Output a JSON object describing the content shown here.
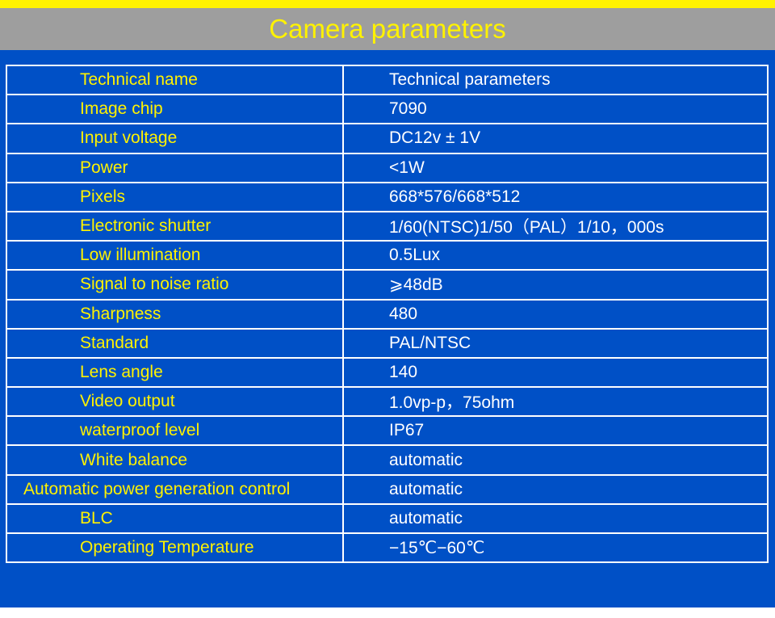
{
  "title": "Camera parameters",
  "colors": {
    "accent_yellow": "#fff200",
    "title_bg": "#9e9e9e",
    "panel_blue": "#0050c6"
  },
  "table": {
    "header": {
      "name": "Technical name",
      "value": "Technical parameters"
    },
    "rows": [
      {
        "name": "Image chip",
        "value": "7090"
      },
      {
        "name": "Input voltage",
        "value": "DC12v ± 1V"
      },
      {
        "name": "Power",
        "value": "<1W"
      },
      {
        "name": "Pixels",
        "value": "668*576/668*512"
      },
      {
        "name": "Electronic shutter",
        "value": "1/60(NTSC)1/50（PAL）1/10，000s"
      },
      {
        "name": "Low illumination",
        "value": "0.5Lux"
      },
      {
        "name": "Signal to noise ratio",
        "value": "⩾48dB"
      },
      {
        "name": "Sharpness",
        "value": "480"
      },
      {
        "name": "Standard",
        "value": "PAL/NTSC"
      },
      {
        "name": "Lens angle",
        "value": "140"
      },
      {
        "name": "Video output",
        "value": "1.0vp-p，75ohm"
      },
      {
        "name": "waterproof level",
        "value": "IP67"
      },
      {
        "name": "White balance",
        "value": "automatic"
      },
      {
        "name": "Automatic power generation control",
        "value": "automatic"
      },
      {
        "name": "BLC",
        "value": "automatic"
      },
      {
        "name": "Operating Temperature",
        "value": "−15℃−60℃"
      }
    ]
  }
}
